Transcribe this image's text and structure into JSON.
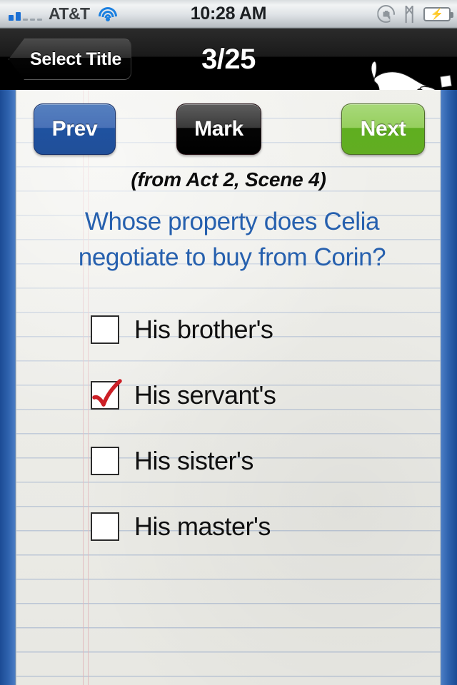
{
  "status_bar": {
    "carrier": "AT&T",
    "time": "10:28 AM",
    "signal_bars_filled": 2,
    "signal_bars_total": 5,
    "wifi_icon": "wifi-icon",
    "rotation_lock_icon": "rotation-lock-icon",
    "bluetooth_icon": "bluetooth-icon",
    "bluetooth_glyph": "ᛗ",
    "battery_icon": "battery-charging-icon",
    "battery_bolt": "⚡"
  },
  "nav_bar": {
    "back_label": "Select Title",
    "title": "3/25",
    "logo_name": "cliffsnotes-dog-logo"
  },
  "toolbar": {
    "prev_label": "Prev",
    "mark_label": "Mark",
    "next_label": "Next"
  },
  "quiz": {
    "source": "(from Act 2, Scene 4)",
    "question": "Whose property does Celia negotiate to buy from Corin?",
    "options": [
      {
        "label": "His brother's",
        "checked": false
      },
      {
        "label": "His servant's",
        "checked": true
      },
      {
        "label": "His sister's",
        "checked": false
      },
      {
        "label": "His master's",
        "checked": false
      }
    ]
  },
  "colors": {
    "question_blue": "#2660ae",
    "prev_blue": "#1f52a0",
    "next_green": "#5fae20",
    "mark_black": "#000000",
    "check_red": "#cc1f26",
    "paper": "#e9e9e4",
    "border_blue": "#1b4b95",
    "rule_line": "#9fb0cc",
    "margin_pink": "#e0a6ad"
  }
}
